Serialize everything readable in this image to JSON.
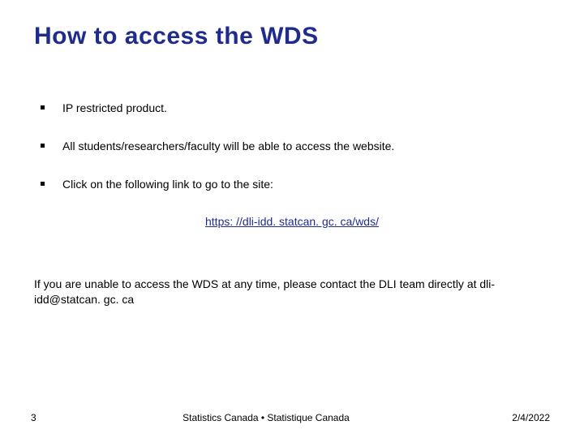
{
  "title": "How to access the WDS",
  "bullets": [
    "IP restricted product.",
    "All students/researchers/faculty will be able to access the website.",
    "Click on the following link to go to the site:"
  ],
  "link": {
    "text": "https: //dli-idd. statcan. gc. ca/wds/"
  },
  "paragraph": "If you are unable to access the WDS at any time, please contact the DLI team directly at dli-idd@statcan. gc. ca",
  "footer": {
    "page": "3",
    "center": "Statistics Canada • Statistique Canada",
    "date": "2/4/2022"
  }
}
